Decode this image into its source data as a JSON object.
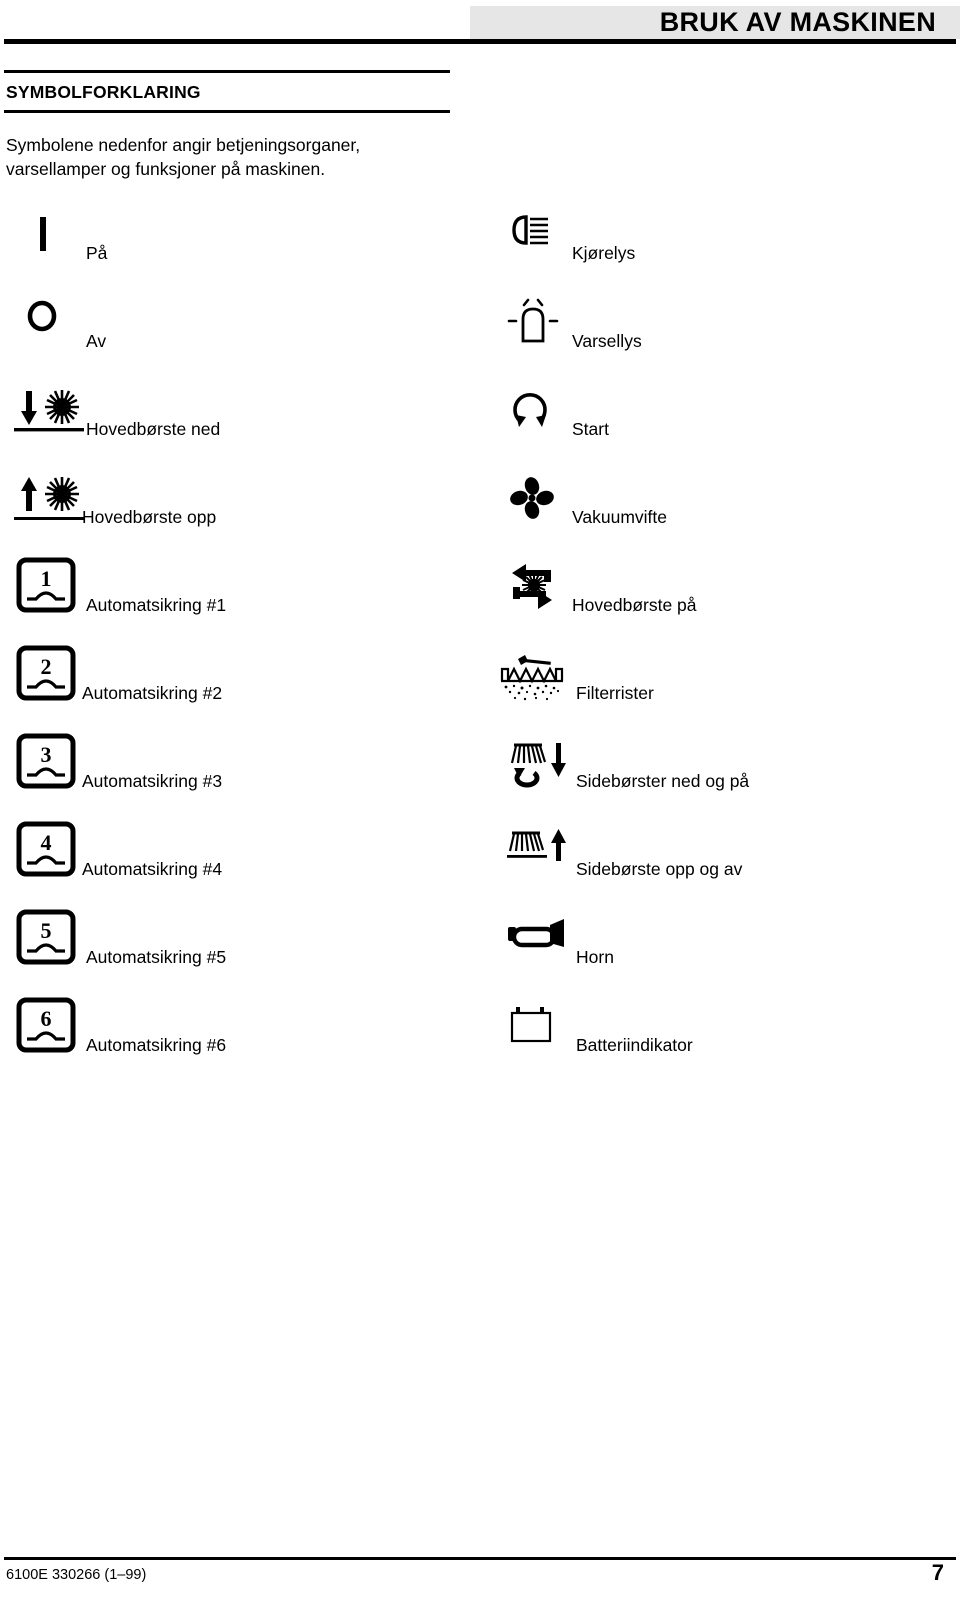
{
  "header": {
    "title": "BRUK AV MASKINEN",
    "band_color": "#e6e6e6"
  },
  "section": {
    "title": "SYMBOLFORKLARING",
    "intro": "Symbolene nedenfor angir betjeningsorganer, varsellamper og funksjoner på maskinen."
  },
  "symbols": {
    "left_column": [
      {
        "icon": "power-on-bar-icon",
        "label": "På"
      },
      {
        "icon": "power-off-circle-icon",
        "label": "Av"
      },
      {
        "icon": "main-brush-down-icon",
        "label": "Hovedbørste ned"
      },
      {
        "icon": "main-brush-up-icon",
        "label": "Hovedbørste opp"
      },
      {
        "icon": "circuit-breaker-1-icon",
        "label": "Automatsikring #1"
      },
      {
        "icon": "circuit-breaker-2-icon",
        "label": "Automatsikring #2"
      },
      {
        "icon": "circuit-breaker-3-icon",
        "label": "Automatsikring #3"
      },
      {
        "icon": "circuit-breaker-4-icon",
        "label": "Automatsikring #4"
      },
      {
        "icon": "circuit-breaker-5-icon",
        "label": "Automatsikring #5"
      },
      {
        "icon": "circuit-breaker-6-icon",
        "label": "Automatsikring #6"
      }
    ],
    "right_column": [
      {
        "icon": "headlight-icon",
        "label": "Kjørelys"
      },
      {
        "icon": "beacon-warning-light-icon",
        "label": "Varsellys"
      },
      {
        "icon": "start-key-icon",
        "label": "Start"
      },
      {
        "icon": "vacuum-fan-icon",
        "label": "Vakuumvifte"
      },
      {
        "icon": "main-brush-rotate-icon",
        "label": "Hovedbørste på"
      },
      {
        "icon": "filter-shaker-icon",
        "label": "Filterrister"
      },
      {
        "icon": "side-brush-down-on-icon",
        "label": "Sidebørster ned og på"
      },
      {
        "icon": "side-brush-up-off-icon",
        "label": "Sidebørste opp og av"
      },
      {
        "icon": "horn-icon",
        "label": "Horn"
      },
      {
        "icon": "battery-indicator-icon",
        "label": "Batteriindikator"
      }
    ],
    "breaker_numbers": [
      "1",
      "2",
      "3",
      "4",
      "5",
      "6"
    ]
  },
  "footer": {
    "document_code": "6100E 330266 (1–99)",
    "page_number": "7"
  }
}
